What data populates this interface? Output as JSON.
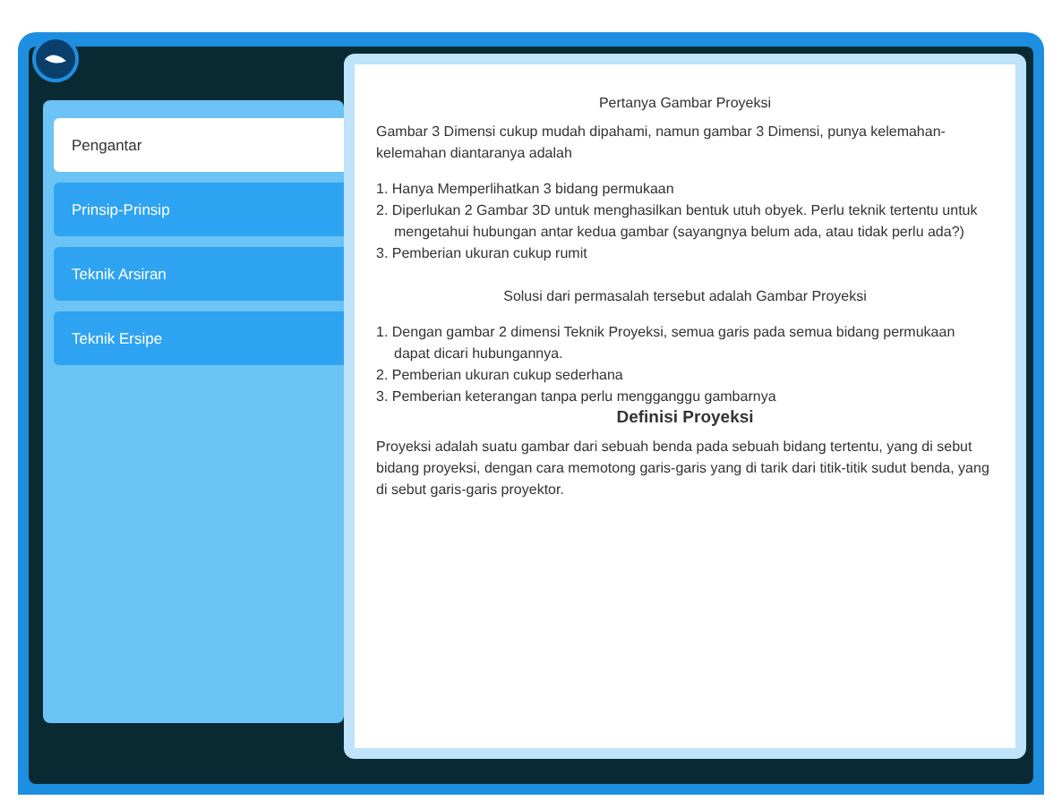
{
  "sidebar": {
    "items": [
      {
        "label": "Pengantar",
        "selected": true
      },
      {
        "label": "Prinsip-Prinsip",
        "selected": false
      },
      {
        "label": "Teknik Arsiran",
        "selected": false
      },
      {
        "label": "Teknik Ersipe",
        "selected": false
      }
    ]
  },
  "content": [
    {
      "kind": "title",
      "text": "Pertanya Gambar Proyeksi"
    },
    {
      "kind": "paragraph",
      "text": "Gambar 3 Dimensi cukup mudah dipahami, namun gambar 3 Dimensi, punya kelemahan-kelemahan  diantaranya adalah"
    },
    {
      "kind": "list",
      "items": [
        "1. Hanya Memperlihatkan 3 bidang permukaan",
        "2. Diperlukan 2 Gambar 3D untuk menghasilkan bentuk utuh obyek. Perlu teknik tertentu untuk  mengetahui hubungan antar kedua gambar (sayangnya belum ada, atau tidak perlu ada?)",
        "3. Pemberian ukuran cukup rumit"
      ]
    },
    {
      "kind": "title",
      "text": "Solusi dari permasalah tersebut adalah Gambar Proyeksi"
    },
    {
      "kind": "list",
      "items": [
        "1. Dengan gambar 2 dimensi Teknik Proyeksi, semua garis pada semua bidang permukaan dapat dicari hubungannya.",
        "2. Pemberian ukuran cukup sederhana",
        "3. Pemberian keterangan tanpa perlu mengganggu gambarnya"
      ]
    },
    {
      "kind": "heading",
      "text": "Definisi Proyeksi"
    },
    {
      "kind": "paragraph",
      "text": "Proyeksi adalah suatu gambar dari sebuah benda pada sebuah bidang tertentu, yang di sebut bidang proyeksi, dengan cara memotong garis-garis yang di tarik dari titik-titik sudut benda, yang di sebut garis-garis proyektor."
    }
  ]
}
